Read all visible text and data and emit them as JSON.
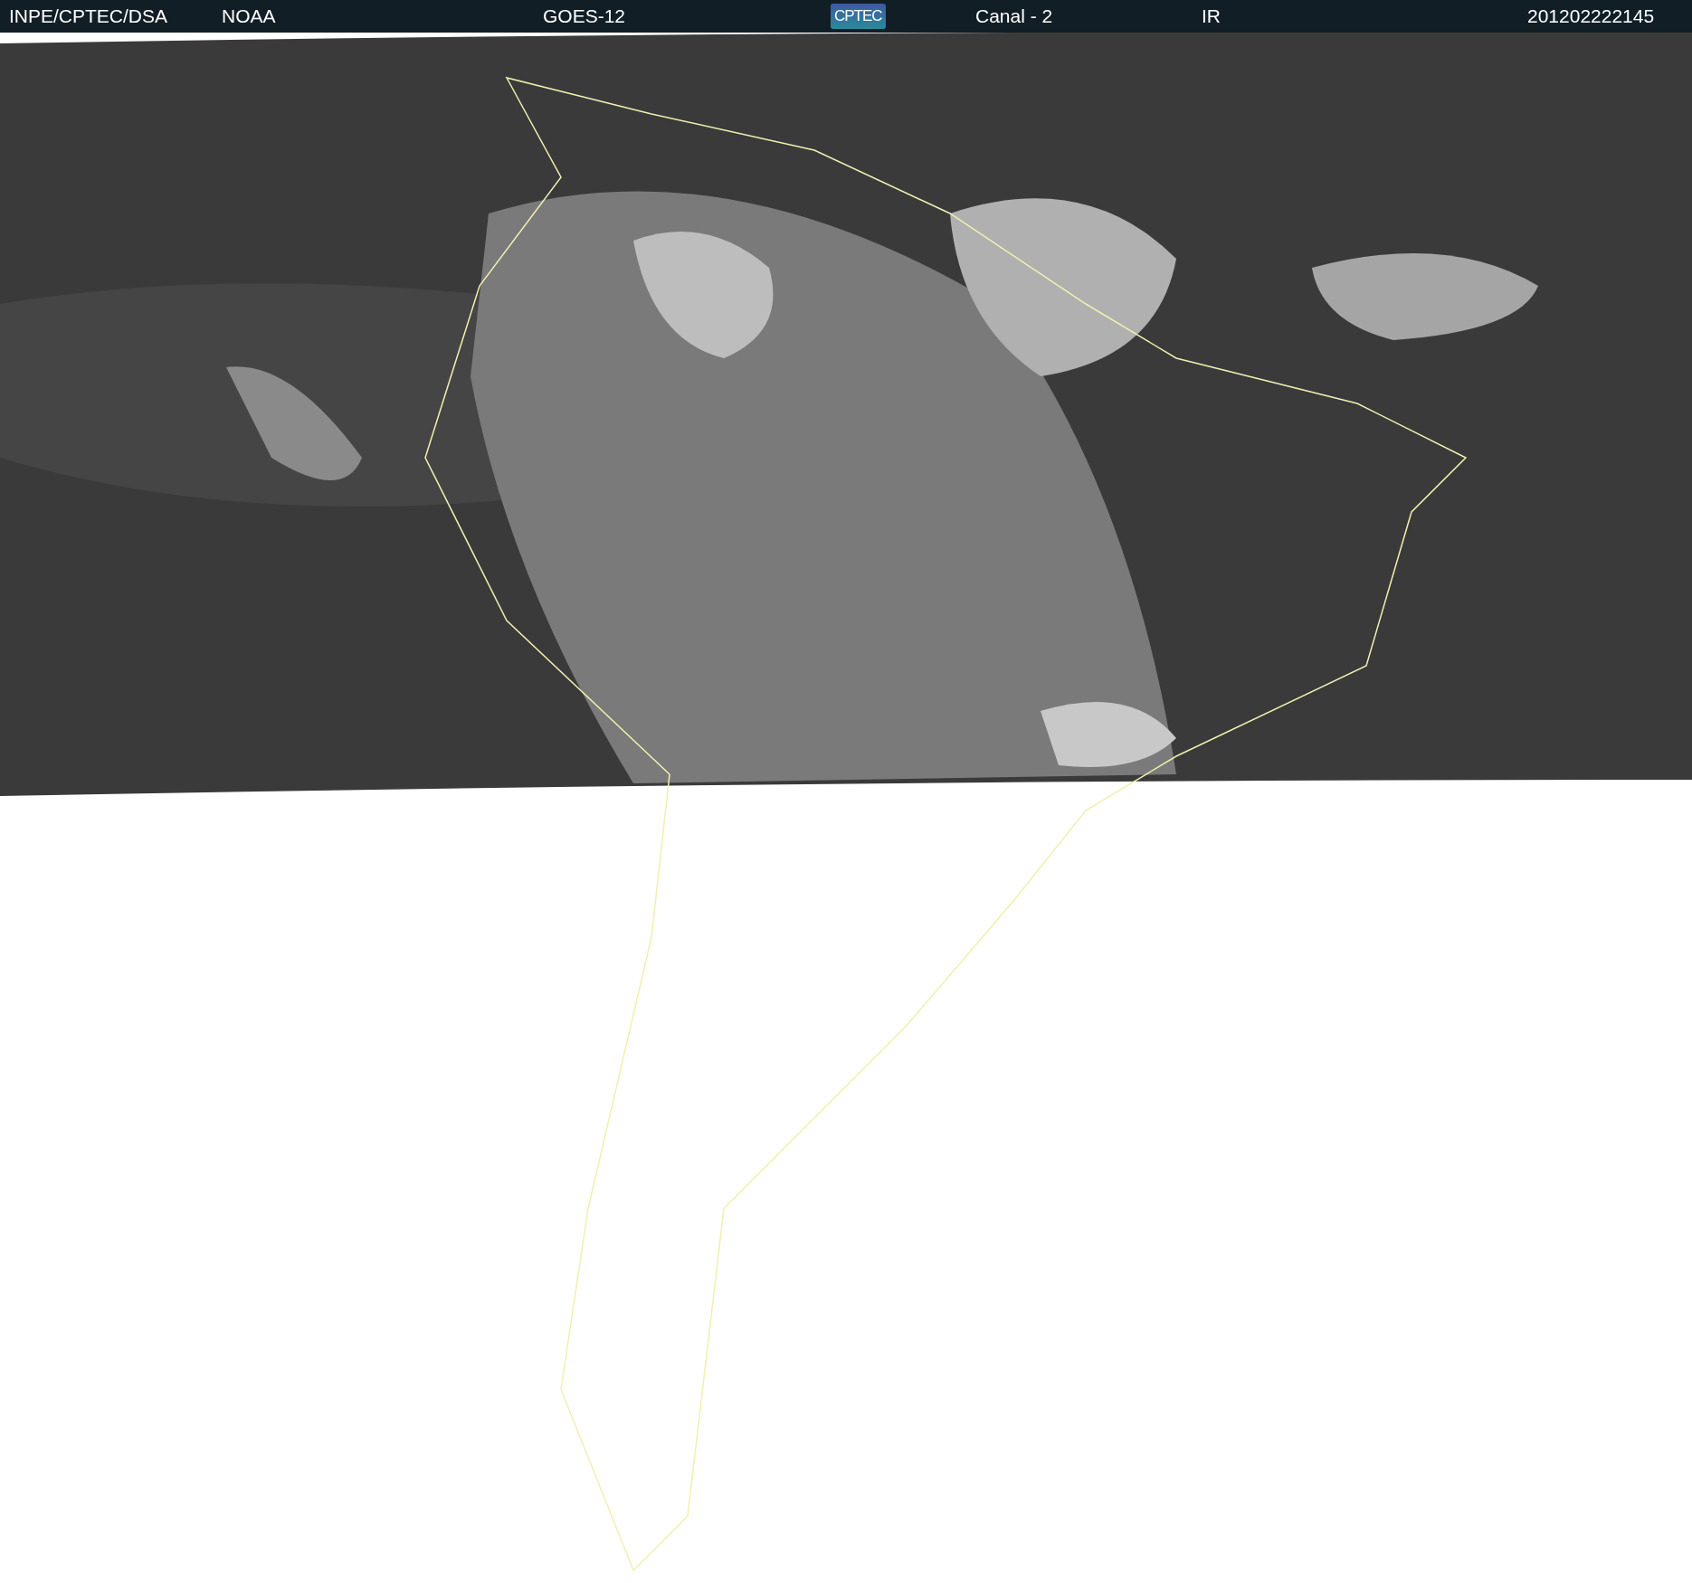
{
  "header": {
    "items": [
      {
        "kind": "text",
        "text": "INPE/CPTEC/DSA"
      },
      {
        "kind": "text",
        "text": "NOAA"
      },
      {
        "kind": "text",
        "text": "GOES-12"
      },
      {
        "kind": "logo",
        "text": "CPTEC"
      },
      {
        "kind": "text",
        "text": "Canal - 2"
      },
      {
        "kind": "text",
        "text": "IR"
      },
      {
        "kind": "text",
        "text": "201202222145"
      }
    ]
  }
}
